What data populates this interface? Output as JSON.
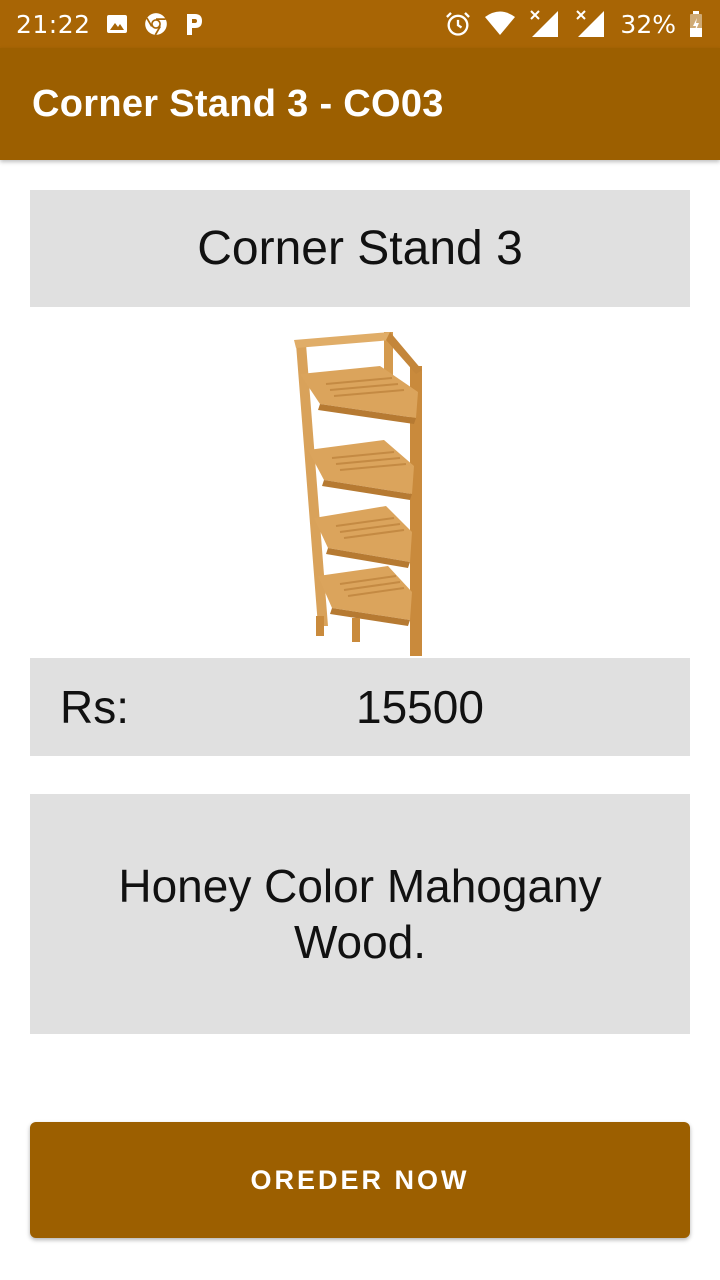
{
  "status_bar": {
    "time": "21:22",
    "battery_percent": "32%",
    "background_color": "#a86505",
    "left_icons": [
      "image-icon",
      "chrome-icon",
      "parking-p-icon"
    ],
    "right_icons": [
      "alarm-icon",
      "wifi-icon",
      "signal-1-no-data-icon",
      "signal-2-no-data-icon",
      "battery-charging-icon"
    ]
  },
  "app_bar": {
    "title": "Corner Stand 3 - CO03",
    "background_color": "#9c5f00"
  },
  "product": {
    "name": "Corner Stand 3",
    "image": "wooden-corner-stand-image",
    "price_label": "Rs:",
    "price": "15500",
    "description": "Honey Color Mahogany Wood."
  },
  "order_button": {
    "label": "OREDER NOW",
    "background_color": "#9c5f00"
  },
  "panel_color": "#e0e0e0"
}
